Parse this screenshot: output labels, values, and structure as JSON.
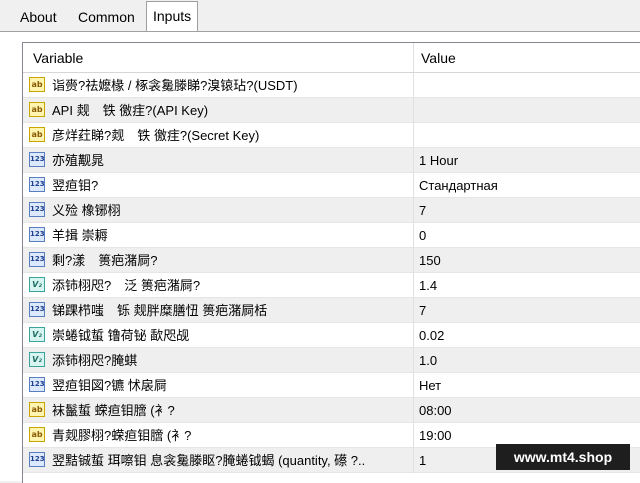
{
  "tabs": [
    {
      "label": "About",
      "active": false
    },
    {
      "label": "Common",
      "active": false
    },
    {
      "label": "Inputs",
      "active": true
    }
  ],
  "grid": {
    "headers": {
      "variable": "Variable",
      "value": "Value"
    },
    "rows": [
      {
        "icon": "string-icon",
        "name": "诣赍?祛嬷椽 / 椓衾毚滕睇?溴锿玷?(USDT)",
        "value": ""
      },
      {
        "icon": "string-icon",
        "name": "API 觌　铁 徼疰?(API Key)",
        "value": ""
      },
      {
        "icon": "string-icon",
        "name": "彦烊荭睇?觌　铁 徼疰?(Secret Key)",
        "value": ""
      },
      {
        "icon": "integer-icon",
        "name": "亦殖觏晁",
        "value": "1 Hour"
      },
      {
        "icon": "integer-icon",
        "name": "翌疸钼?",
        "value": "Стандартная"
      },
      {
        "icon": "integer-icon",
        "name": "义殓 橡铘栩",
        "value": "7"
      },
      {
        "icon": "integer-icon",
        "name": "羊揖 崇耨",
        "value": "0"
      },
      {
        "icon": "integer-icon",
        "name": "剩?漾　篑疤潴屙?",
        "value": "150"
      },
      {
        "icon": "double-icon",
        "name": "添铈栩咫?　泛 篑疤潴屙?",
        "value": "1.4"
      },
      {
        "icon": "integer-icon",
        "name": "锑踝栉嗤　铄 觌胖糜膳忸 篑疤潴屙栝",
        "value": "7"
      },
      {
        "icon": "double-icon",
        "name": "崇蜷钺蜇 镥荷铋 歃咫觇",
        "value": "0.02"
      },
      {
        "icon": "double-icon",
        "name": "添铈栩咫?腌蜞",
        "value": "1.0"
      },
      {
        "icon": "integer-icon",
        "name": "翌疸钼図?镳 怵扆屙",
        "value": "Нет"
      },
      {
        "icon": "string-icon",
        "name": "袜鬣蜇 蝾疸钼膪 (衤?",
        "value": "08:00"
      },
      {
        "icon": "string-icon",
        "name": "青觌膠栩?蝾疸钼膪 (衤?",
        "value": "19:00"
      },
      {
        "icon": "integer-icon",
        "name": "翌黠铖蜇 珥嚓钼 息衾毚滕眍?腌蜷钺蝎 (quantity, 礤 ?..",
        "value": "1"
      }
    ]
  },
  "watermark": "www.mt4.shop"
}
